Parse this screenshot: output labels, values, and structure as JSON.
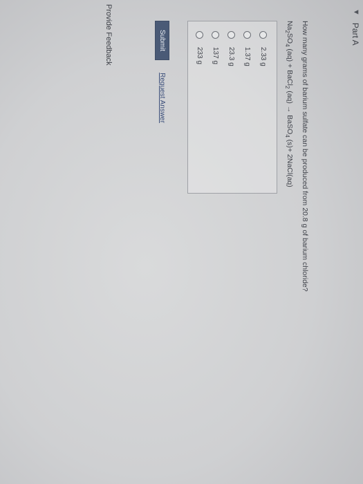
{
  "part": {
    "caret": "▼",
    "title": "Part A"
  },
  "question": {
    "text": "How many grams of barium sulfate can be produced from 20.8 g of barium chloride?",
    "equation": {
      "na": "Na",
      "s2": "2",
      "so4a": "SO",
      "s4a": "4",
      "mid1": " (aq) + BaCl",
      "s2b": "2",
      "mid2": " (aq) → BaSO",
      "s4b": "4",
      "end": " (s)+ 2NaCl(aq)"
    }
  },
  "choices": [
    {
      "label": "2.33 g"
    },
    {
      "label": "1.37 g"
    },
    {
      "label": "23.3 g"
    },
    {
      "label": "137 g"
    },
    {
      "label": "233 g"
    }
  ],
  "actions": {
    "submit": "Submit",
    "request": "Request Answer"
  },
  "footer": {
    "feedback": "Provide Feedback"
  }
}
